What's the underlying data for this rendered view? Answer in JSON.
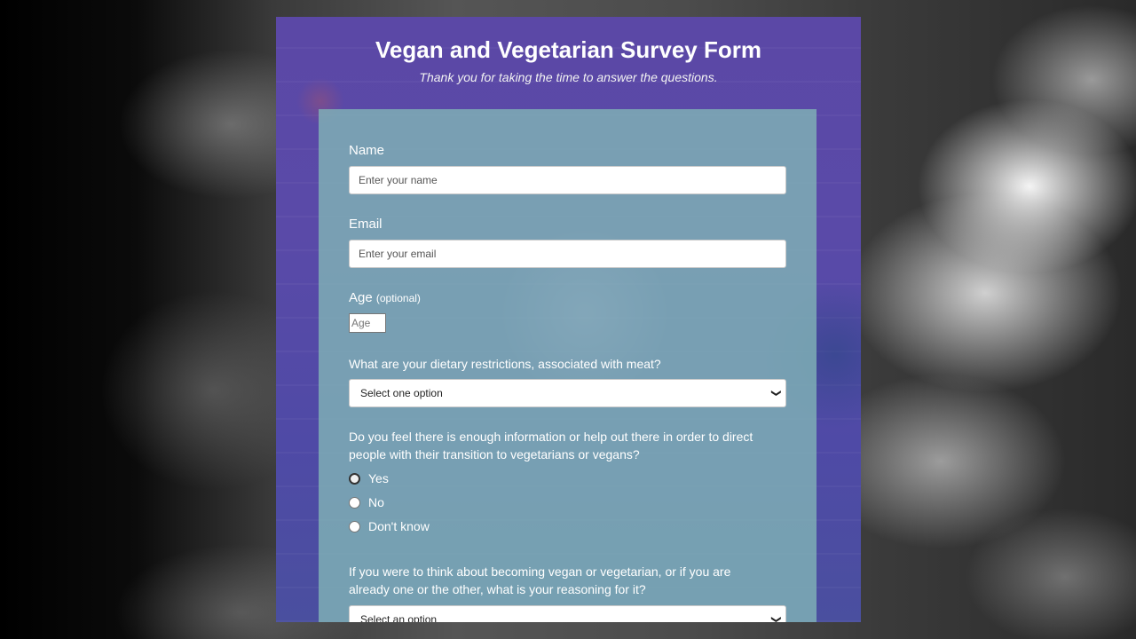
{
  "header": {
    "title": "Vegan and Vegetarian Survey Form",
    "subtitle": "Thank you for taking the time to answer the questions."
  },
  "form": {
    "name": {
      "label": "Name",
      "placeholder": "Enter your name"
    },
    "email": {
      "label": "Email",
      "placeholder": "Enter your email"
    },
    "age": {
      "label": "Age",
      "optional": "(optional)",
      "placeholder": "Age"
    },
    "dietary": {
      "question": "What are your dietary restrictions, associated with meat?",
      "selected": "Select one option"
    },
    "info": {
      "question": "Do you feel there is enough information or help out there in order to direct people with their transition to vegetarians or vegans?",
      "options": [
        "Yes",
        "No",
        "Don't know"
      ]
    },
    "reasoning": {
      "question": "If you were to think about becoming vegan or vegetarian, or if you are already one or the other, what is your reasoning for it?",
      "selected": "Select an option"
    }
  },
  "colors": {
    "card_background": "#5a4aa8",
    "panel_background": "#80b2b6",
    "text": "#ffffff"
  }
}
